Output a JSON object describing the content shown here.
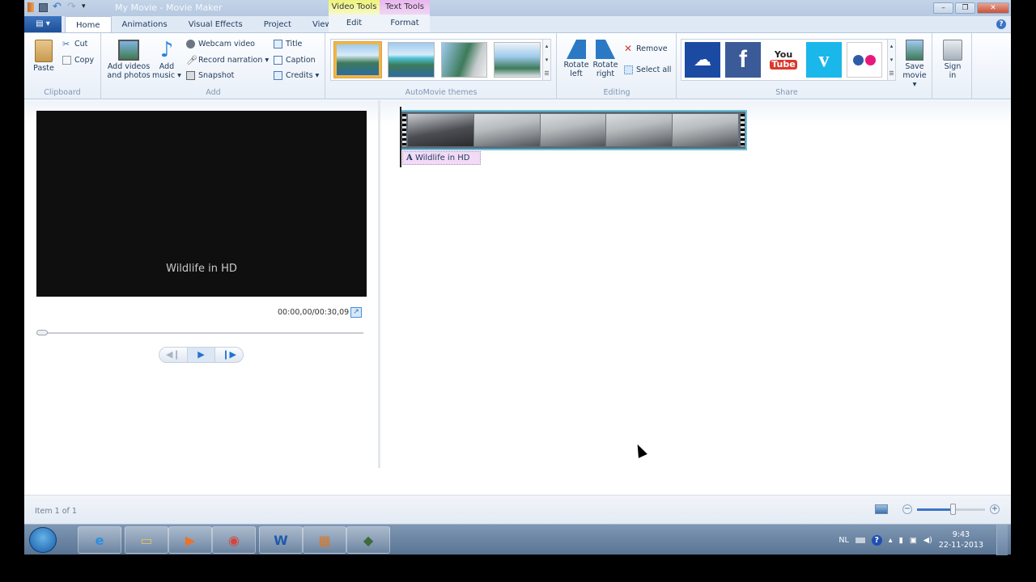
{
  "window": {
    "title": "My Movie - Movie Maker",
    "buttons": {
      "minimize": "–",
      "restore": "❐",
      "close": "✕"
    },
    "quick_access": [
      "app-icon",
      "save-icon",
      "undo-icon",
      "redo-icon",
      "customize-icon"
    ]
  },
  "contextual_tabs": [
    {
      "header": "Video Tools",
      "tab": "Edit",
      "color": "#eef37a"
    },
    {
      "header": "Text Tools",
      "tab": "Format",
      "color": "#e8b7ee"
    }
  ],
  "tabs": [
    {
      "label": "Home",
      "active": true
    },
    {
      "label": "Animations",
      "active": false
    },
    {
      "label": "Visual Effects",
      "active": false
    },
    {
      "label": "Project",
      "active": false
    },
    {
      "label": "View",
      "active": false
    }
  ],
  "file_menu_glyph": "▤ ▾",
  "help_glyph": "?",
  "ribbon": {
    "clipboard": {
      "label": "Clipboard",
      "paste": "Paste",
      "cut": "Cut",
      "copy": "Copy"
    },
    "add": {
      "label": "Add",
      "add_videos_1": "Add videos",
      "add_videos_2": "and photos",
      "add_music_1": "Add",
      "add_music_2": "music ▾",
      "webcam": "Webcam video",
      "record": "Record narration ▾",
      "snapshot": "Snapshot",
      "title": "Title",
      "caption": "Caption",
      "credits": "Credits ▾"
    },
    "themes": {
      "label": "AutoMovie themes",
      "count": 4,
      "selected_index": 0
    },
    "editing": {
      "label": "Editing",
      "rotate_left_1": "Rotate",
      "rotate_left_2": "left",
      "rotate_right_1": "Rotate",
      "rotate_right_2": "right",
      "remove": "Remove",
      "select_all": "Select all"
    },
    "share": {
      "label": "Share",
      "services": [
        "SkyDrive",
        "Facebook",
        "YouTube",
        "Vimeo",
        "Flickr"
      ],
      "save_movie_1": "Save",
      "save_movie_2": "movie ▾",
      "sign_in_1": "Sign",
      "sign_in_2": "in"
    }
  },
  "preview": {
    "caption": "Wildlife in HD",
    "timecode": "00:00,00/00:30,09",
    "seek_progress": 0,
    "controls": {
      "prev": "◀❙",
      "play": "▶",
      "next": "❙▶"
    }
  },
  "storyboard": {
    "frames": 5,
    "caption_label": "A",
    "caption_text": "Wildlife in HD"
  },
  "status": {
    "item_count": "Item 1 of 1",
    "zoom_level": 0.52,
    "zoom_minus": "−",
    "zoom_plus": "+"
  },
  "taskbar": {
    "apps": [
      {
        "name": "internet-explorer",
        "glyph": "e",
        "color": "#2a8fe0"
      },
      {
        "name": "file-explorer",
        "glyph": "▭",
        "color": "#e5c45a"
      },
      {
        "name": "media-player",
        "glyph": "▶",
        "color": "#e8732a"
      },
      {
        "name": "chrome",
        "glyph": "◉",
        "color": "#d9443a"
      },
      {
        "name": "word",
        "glyph": "W",
        "color": "#1f5aab"
      },
      {
        "name": "movie-maker",
        "glyph": "▦",
        "color": "#d9782a"
      },
      {
        "name": "other-app",
        "glyph": "◆",
        "color": "#3f6a3a"
      }
    ],
    "tray": {
      "language": "NL",
      "time": "9:43",
      "date": "22-11-2013"
    }
  }
}
